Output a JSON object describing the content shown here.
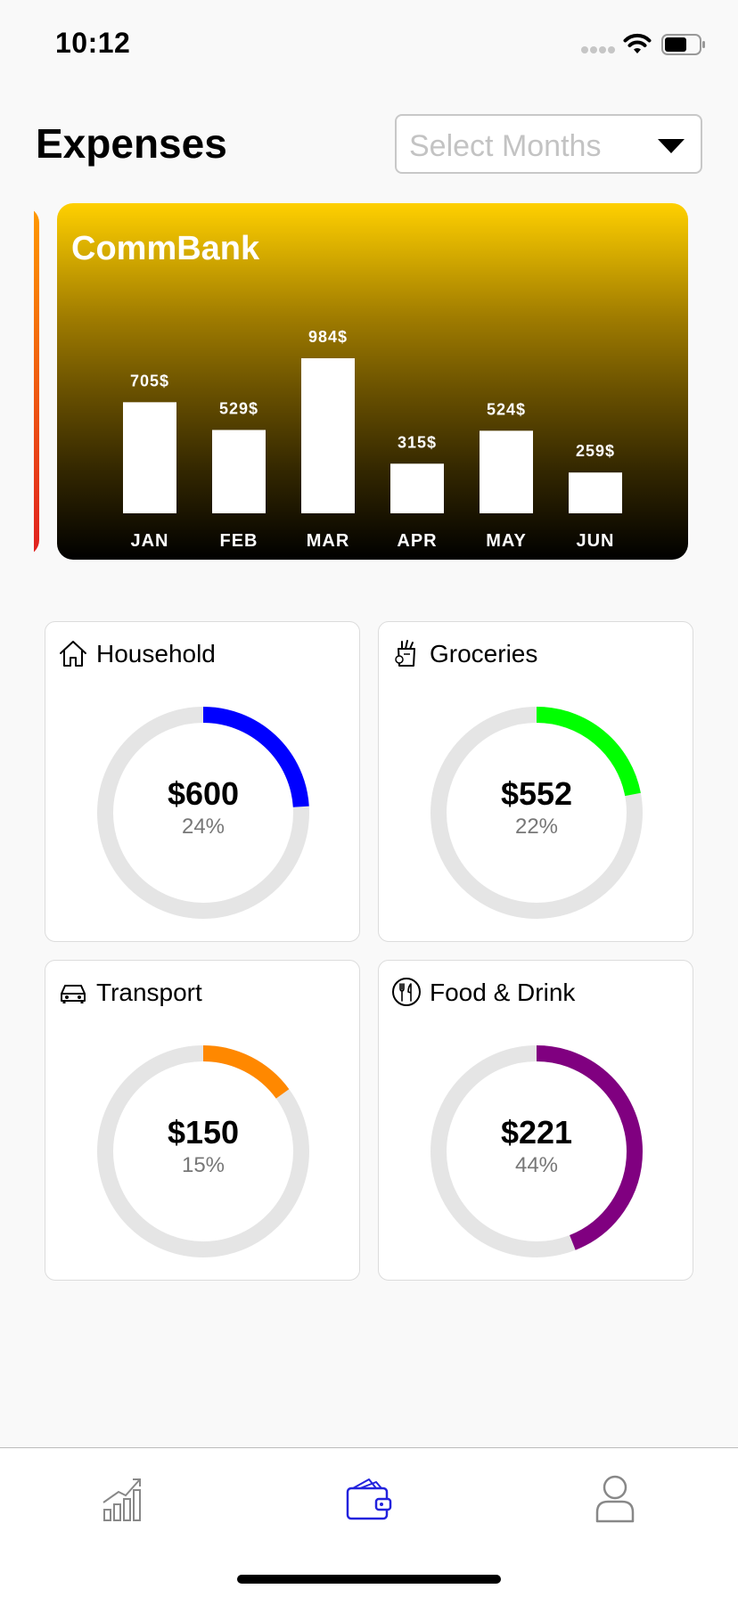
{
  "status_bar": {
    "time": "10:12"
  },
  "header": {
    "title": "Expenses",
    "month_select_placeholder": "Select Months"
  },
  "bank_card": {
    "name": "CommBank",
    "gradient_colors": [
      "#ffd000",
      "#000000"
    ]
  },
  "chart_data": {
    "type": "bar",
    "categories": [
      "JAN",
      "FEB",
      "MAR",
      "APR",
      "MAY",
      "JUN"
    ],
    "values": [
      705,
      529,
      984,
      315,
      524,
      259
    ],
    "value_labels": [
      "705$",
      "529$",
      "984$",
      "315$",
      "524$",
      "259$"
    ],
    "title": "",
    "xlabel": "",
    "ylabel": "",
    "ylim": [
      0,
      984
    ],
    "bar_color": "#ffffff",
    "grid": false
  },
  "categories": [
    {
      "label": "Household",
      "icon": "house-icon",
      "amount": "$600",
      "percent_text": "24%",
      "fraction": 0.24,
      "color": "#0000ff"
    },
    {
      "label": "Groceries",
      "icon": "grocery-bag-icon",
      "amount": "$552",
      "percent_text": "22%",
      "fraction": 0.22,
      "color": "#00ff00"
    },
    {
      "label": "Transport",
      "icon": "car-icon",
      "amount": "$150",
      "percent_text": "15%",
      "fraction": 0.15,
      "color": "#ff8800"
    },
    {
      "label": "Food & Drink",
      "icon": "fork-knife-icon",
      "amount": "$221",
      "percent_text": "44%",
      "fraction": 0.44,
      "color": "#800080"
    }
  ],
  "tab_bar": {
    "tabs": [
      {
        "icon": "chart-growth-icon",
        "active": false
      },
      {
        "icon": "wallet-icon",
        "active": true
      },
      {
        "icon": "profile-icon",
        "active": false
      }
    ],
    "active_color": "#2222dd",
    "inactive_color": "#888888"
  }
}
